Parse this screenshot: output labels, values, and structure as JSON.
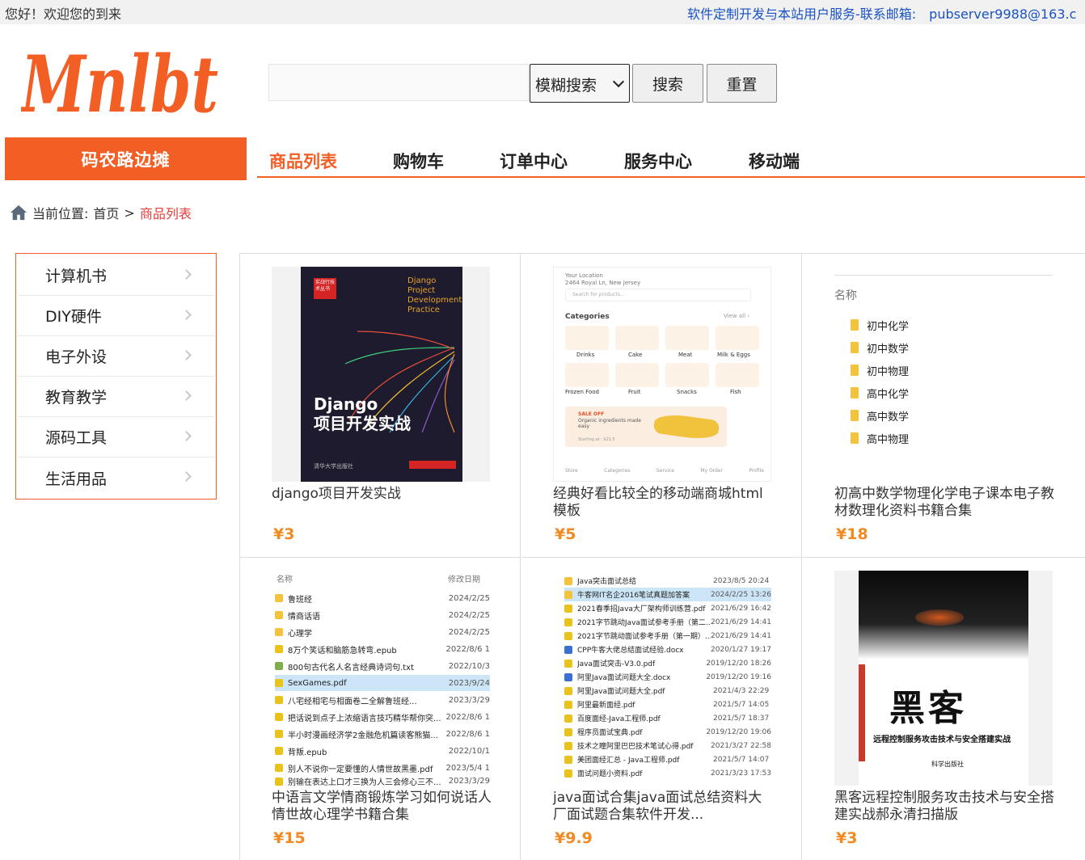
{
  "topbar": {
    "greeting": "您好！欢迎您的到来",
    "contact_label": "软件定制开发与本站用户服务-联系邮箱:",
    "email": "pubserver9988@163.c"
  },
  "header": {
    "logo_text": "Mnlbt",
    "search_placeholder": "",
    "search_mode": "模糊搜索",
    "search_button": "搜索",
    "reset_button": "重置"
  },
  "nav": {
    "category_title": "码农路边摊",
    "items": [
      "商品列表",
      "购物车",
      "订单中心",
      "服务中心",
      "移动端"
    ],
    "active": "商品列表"
  },
  "breadcrumb": {
    "label": "当前位置:",
    "home": "首页",
    "separator": ">",
    "current": "商品列表"
  },
  "sidebar": {
    "items": [
      "计算机书",
      "DIY硬件",
      "电子外设",
      "教育教学",
      "源码工具",
      "生活用品"
    ]
  },
  "products": [
    {
      "title": "django项目开发实战",
      "price": "¥3",
      "cover": {
        "tag": "实战行技术丛书",
        "english": "Django Project Development Practice",
        "title_line1": "Django",
        "title_line2": "项目开发实战",
        "publisher": "清华大学出版社"
      }
    },
    {
      "title": "经典好看比较全的移动端商城html模板",
      "price": "¥5",
      "cover": {
        "location_label": "Your Location",
        "location": "2464 Royal Ln, New Jersey",
        "search_placeholder": "Search for products...",
        "categories": "Categories",
        "view_all": "View all ›",
        "tiles": [
          "Drinks",
          "Cake",
          "Meat",
          "Milk & Eggs",
          "Frozen Food",
          "Fruit",
          "Snacks",
          "Fish"
        ],
        "sale": "SALE OFF",
        "sale_text": "Organic ingredients made easy",
        "sale_price": "Starting at : $21.5",
        "tabs": [
          "Store",
          "Categories",
          "Service",
          "My Order",
          "Profile"
        ]
      }
    },
    {
      "title": "初高中数学物理化学电子课本电子教材数理化资料书籍合集",
      "price": "¥18",
      "cover": {
        "header": "名称",
        "folders": [
          "初中化学",
          "初中数学",
          "初中物理",
          "高中化学",
          "高中数学",
          "高中物理"
        ]
      }
    },
    {
      "title": "中语言文学情商锻炼学习如何说话人情世故心理学书籍合集",
      "price": "¥15",
      "cover": {
        "header_name": "名称",
        "header_date": "修改日期",
        "rows": [
          {
            "name": "鲁班经",
            "date": "2024/2/25"
          },
          {
            "name": "情商话语",
            "date": "2024/2/25"
          },
          {
            "name": "心理学",
            "date": "2024/2/25"
          },
          {
            "name": "8万个笑话和脑筋急转弯.epub",
            "date": "2022/8/6 1"
          },
          {
            "name": "800句古代名人名言经典诗词句.txt",
            "date": "2022/10/3"
          },
          {
            "name": "SexGames.pdf",
            "date": "2023/9/24"
          },
          {
            "name": "八宅经相宅与相面卷二全解鲁班经...",
            "date": "2023/3/29"
          },
          {
            "name": "把话说到点子上浓缩语言技巧精华帮你突...",
            "date": "2022/8/6 1"
          },
          {
            "name": "半小时漫画经济学2金融危机篇读客熊猫...",
            "date": "2022/8/6 1"
          },
          {
            "name": "背叛.epub",
            "date": "2022/10/1"
          },
          {
            "name": "别人不说你一定要懂的人情世故黑墨.pdf",
            "date": "2023/5/4 1"
          },
          {
            "name": "别输在表达上口才三换为人三会修心三不...",
            "date": "2023/3/29"
          }
        ]
      }
    },
    {
      "title": "java面试合集java面试总结资料大厂面试题合集软件开发...",
      "price": "¥9.9",
      "cover": {
        "rows": [
          {
            "name": "Java突击面试总结",
            "date": "2023/8/5 20:24"
          },
          {
            "name": "牛客网IT名企2016笔试真题加答案",
            "date": "2024/2/25 13:26"
          },
          {
            "name": "2021春季招Java大厂架构师训练营.pdf",
            "date": "2021/6/29 16:42"
          },
          {
            "name": "2021字节跳动Java面试参考手册（第二...",
            "date": "2021/6/29 14:41"
          },
          {
            "name": "2021字节跳动面试参考手册（第一期）...",
            "date": "2021/6/29 14:41"
          },
          {
            "name": "CPP牛客大佬总结面试经验.docx",
            "date": "2020/1/27 19:17"
          },
          {
            "name": "Java面试突击-V3.0.pdf",
            "date": "2019/12/20 18:26"
          },
          {
            "name": "阿里Java面试问题大全.docx",
            "date": "2019/12/20 19:16"
          },
          {
            "name": "阿里Java面试问题大全.pdf",
            "date": "2021/4/3 22:29"
          },
          {
            "name": "阿里最新面经.pdf",
            "date": "2021/5/7 14:05"
          },
          {
            "name": "百度面经-Java工程师.pdf",
            "date": "2021/5/7 18:37"
          },
          {
            "name": "程序员面试宝典.pdf",
            "date": "2019/12/20 19:06"
          },
          {
            "name": "技术之瞳阿里巴巴技术笔试心得.pdf",
            "date": "2021/3/27 22:58"
          },
          {
            "name": "美团面经汇总 - Java工程师.pdf",
            "date": "2021/5/7 14:07"
          },
          {
            "name": "面试问题小资料.pdf",
            "date": "2021/3/23 17:53"
          }
        ]
      }
    },
    {
      "title": "黑客远程控制服务攻击技术与安全搭建实战郝永清扫描版",
      "price": "¥3",
      "cover": {
        "title": "黑客",
        "subtitle": "远程控制服务攻击技术与安全搭建实战",
        "publisher": "科学出版社"
      }
    }
  ],
  "colors": {
    "brand": "#f35e25",
    "price": "#f08a21",
    "link": "#1a52c4",
    "breadcrumb_current": "#e23b3b"
  }
}
